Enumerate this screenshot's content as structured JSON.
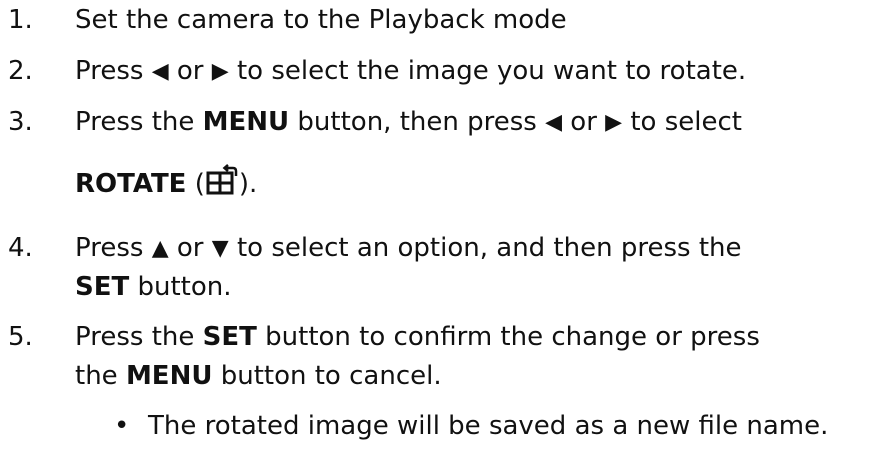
{
  "steps": [
    {
      "number": "1.",
      "text": "Set the camera to the Playback mode"
    },
    {
      "number": "2.",
      "parts": [
        "Press",
        "or",
        "to select the image you want to rotate."
      ]
    },
    {
      "number": "3.",
      "parts": [
        "Press the",
        "MENU",
        "button, then press",
        "or",
        "to select"
      ],
      "cont": [
        "ROTATE",
        "(",
        ")."
      ]
    },
    {
      "number": "4.",
      "parts": [
        "Press",
        "or",
        "to select an option, and then press the"
      ],
      "cont": [
        "SET",
        "button."
      ]
    },
    {
      "number": "5.",
      "parts": [
        "Press the",
        "SET",
        "button to confirm the change or press"
      ],
      "cont": [
        "the",
        "MENU",
        "button to cancel."
      ]
    }
  ],
  "bullet": {
    "symbol": "•",
    "text": "The rotated image will be saved as a new file name."
  },
  "glyphs": {
    "left_arrow": "◀",
    "right_arrow": "▶",
    "up_arrow": "▲",
    "down_arrow": "▼"
  },
  "icons": {
    "rotate": "rotate-icon"
  },
  "colors": {
    "text": "#111111",
    "background": "#ffffff"
  }
}
